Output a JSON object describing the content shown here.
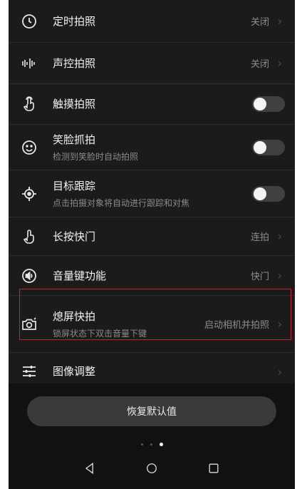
{
  "settings": {
    "items": [
      {
        "title": "定时拍照",
        "value": "关闭",
        "icon": "clock-icon"
      },
      {
        "title": "声控拍照",
        "value": "关闭",
        "icon": "sound-wave-icon"
      },
      {
        "title": "触摸拍照",
        "toggle": false,
        "icon": "touch-icon"
      },
      {
        "title": "笑脸抓拍",
        "subtitle": "检测到笑脸时自动拍照",
        "toggle": false,
        "icon": "smile-icon"
      },
      {
        "title": "目标跟踪",
        "subtitle": "点击拍摄对象将自动进行跟踪和对焦",
        "toggle": false,
        "icon": "target-icon"
      },
      {
        "title": "长按快门",
        "value": "连拍",
        "icon": "hand-tap-icon"
      },
      {
        "title": "音量键功能",
        "value": "快门",
        "icon": "volume-icon"
      },
      {
        "title": "熄屏快拍",
        "subtitle": "锁屏状态下双击音量下键",
        "value": "启动相机并拍照",
        "icon": "camera-icon",
        "highlighted": true
      },
      {
        "title": "图像调整",
        "icon": "sliders-icon"
      }
    ]
  },
  "reset_button": {
    "label": "恢复默认值"
  },
  "pager": {
    "count": 3,
    "active_index": 2
  },
  "navbar": {
    "buttons": [
      "back-icon",
      "home-icon",
      "recents-icon"
    ]
  },
  "colors": {
    "background": "#1b1b1b",
    "highlight": "#c0252b"
  }
}
